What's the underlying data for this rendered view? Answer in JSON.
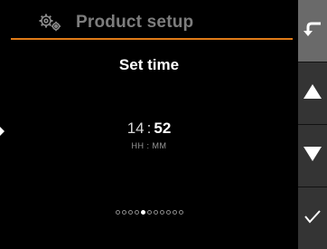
{
  "header": {
    "title": "Product setup",
    "icon": "settings-gears-icon"
  },
  "screen": {
    "title": "Set time"
  },
  "time": {
    "hours": "14",
    "separator": ":",
    "minutes": "52",
    "format": "HH : MM",
    "selected_field": "minutes"
  },
  "pager": {
    "total": 11,
    "current": 5
  },
  "sidebar": {
    "buttons": [
      {
        "name": "back",
        "icon": "back-arrow-icon"
      },
      {
        "name": "up",
        "icon": "triangle-up-icon"
      },
      {
        "name": "down",
        "icon": "triangle-down-icon"
      },
      {
        "name": "confirm",
        "icon": "checkmark-icon"
      }
    ]
  },
  "colors": {
    "background": "#000000",
    "accent": "#e07b18",
    "header_text": "#7d7d7d",
    "sidebar": "#343434",
    "sidebar_back": "#6a6a6a"
  }
}
